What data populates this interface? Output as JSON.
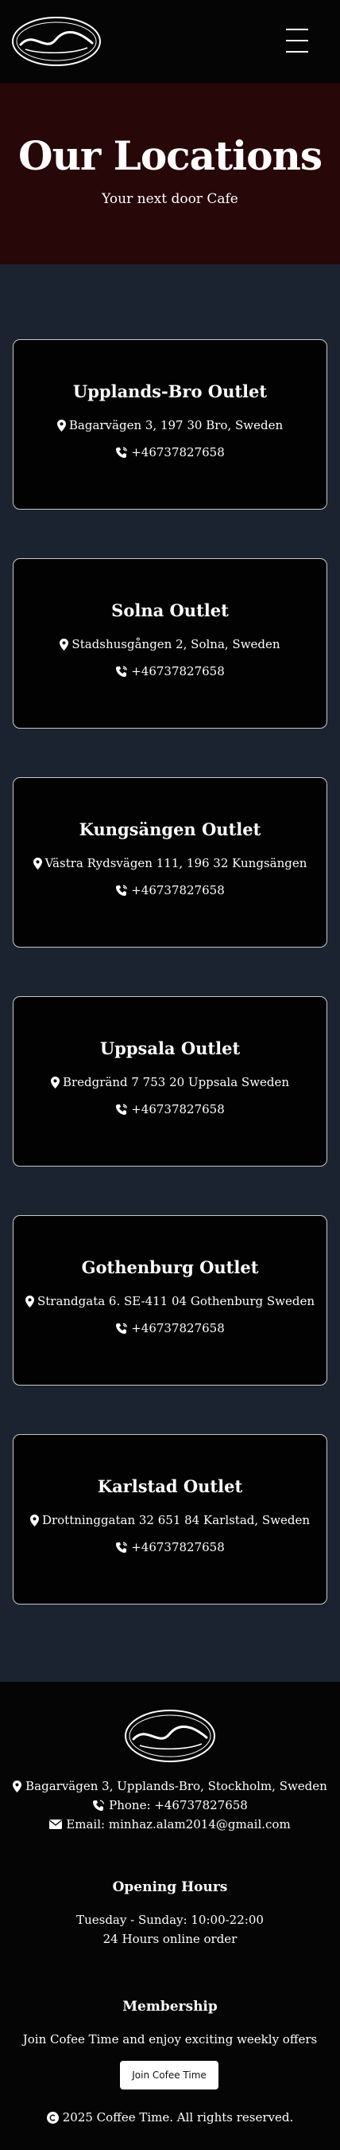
{
  "navbar": {
    "logo_text": "Coffee Time"
  },
  "hero": {
    "title": "Our Locations",
    "subtitle": "Your next door Cafe"
  },
  "locations": [
    {
      "name": "Upplands-Bro Outlet",
      "address": "Bagarvägen 3, 197 30 Bro, Sweden",
      "phone": "+46737827658"
    },
    {
      "name": "Solna Outlet",
      "address": "Stadshusgången 2, Solna, Sweden",
      "phone": "+46737827658"
    },
    {
      "name": "Kungsängen Outlet",
      "address": "Västra Rydsvägen 111, 196 32 Kungsängen",
      "phone": "+46737827658"
    },
    {
      "name": "Uppsala Outlet",
      "address": "Bredgränd 7 753 20 Uppsala Sweden",
      "phone": "+46737827658"
    },
    {
      "name": "Gothenburg Outlet",
      "address": "Strandgata 6. SE-411 04 Gothenburg Sweden",
      "phone": "+46737827658"
    },
    {
      "name": "Karlstad Outlet",
      "address": "Drottninggatan 32 651 84 Karlstad, Sweden",
      "phone": "+46737827658"
    }
  ],
  "footer": {
    "logo_text": "Coffee Time",
    "address": "Bagarvägen 3, Upplands-Bro, Stockholm, Sweden",
    "phone": "Phone: +46737827658",
    "email": "Email: minhaz.alam2014@gmail.com",
    "hours_title": "Opening Hours",
    "hours_days": "Tuesday - Sunday: 10:00-22:00",
    "hours_online": "24 Hours online order",
    "membership_title": "Membership",
    "membership_text": "Join Cofee Time and enjoy exciting weekly offers",
    "join_label": "Join Cofee Time",
    "copyright": "2025 Coffee Time. All rights reserved."
  },
  "colors": {
    "navbar_bg": "#050505",
    "hero_bg": "#270707",
    "section_bg": "#1b2330",
    "card_bg": "#020202",
    "card_border": "#c9c9c9"
  },
  "icons": {
    "address": "map-marker-icon",
    "phone": "phone-volume-icon",
    "email": "envelope-icon",
    "copyright": "copyright-icon"
  }
}
